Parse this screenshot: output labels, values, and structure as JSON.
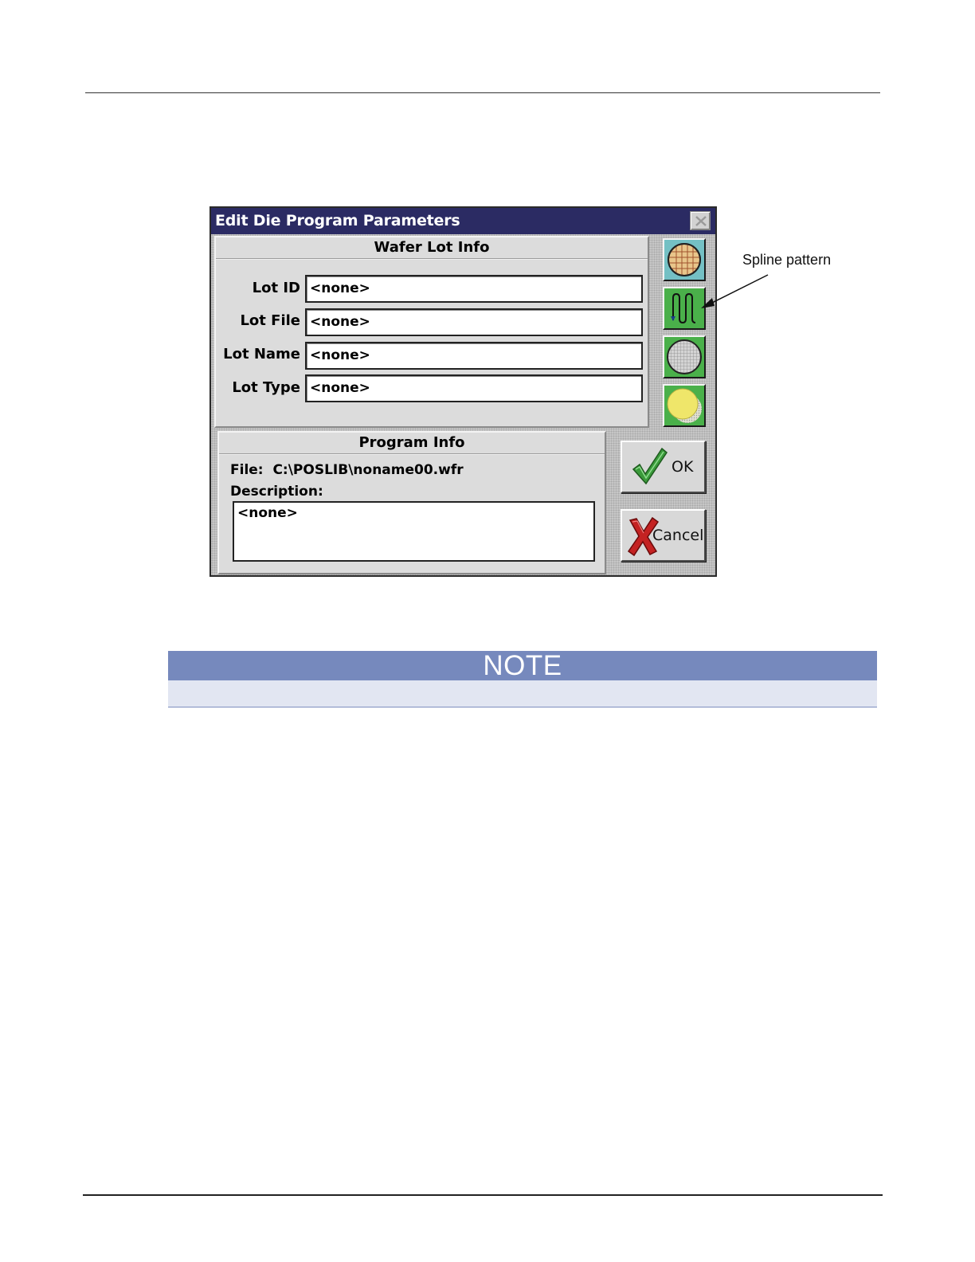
{
  "dialog": {
    "title": "Edit Die Program Parameters",
    "wafer_lot_info": {
      "heading": "Wafer Lot Info",
      "fields": [
        {
          "label": "Lot ID",
          "value": "<none>"
        },
        {
          "label": "Lot File",
          "value": "<none>"
        },
        {
          "label": "Lot Name",
          "value": "<none>"
        },
        {
          "label": "Lot Type",
          "value": "<none>"
        }
      ]
    },
    "program_info": {
      "heading": "Program Info",
      "file_label": "File:",
      "file_value": "C:\\POSLIB\\noname00.wfr",
      "description_label": "Description:",
      "description_value": "<none>"
    },
    "side_buttons": [
      {
        "icon": "wafer-grid-icon",
        "selected": false
      },
      {
        "icon": "spline-pattern-icon",
        "selected": true
      },
      {
        "icon": "wafer-mesh-icon",
        "selected": false
      },
      {
        "icon": "wafer-yellow-icon",
        "selected": false
      }
    ],
    "ok_label": "OK",
    "cancel_label": "Cancel"
  },
  "annotation": {
    "callout_label": "Spline pattern"
  },
  "note": {
    "heading": "NOTE"
  },
  "colors": {
    "titlebar": "#2b2b63",
    "button_green": "#4ab04a",
    "note_header": "#7689bd",
    "note_body": "#e2e6f2"
  }
}
